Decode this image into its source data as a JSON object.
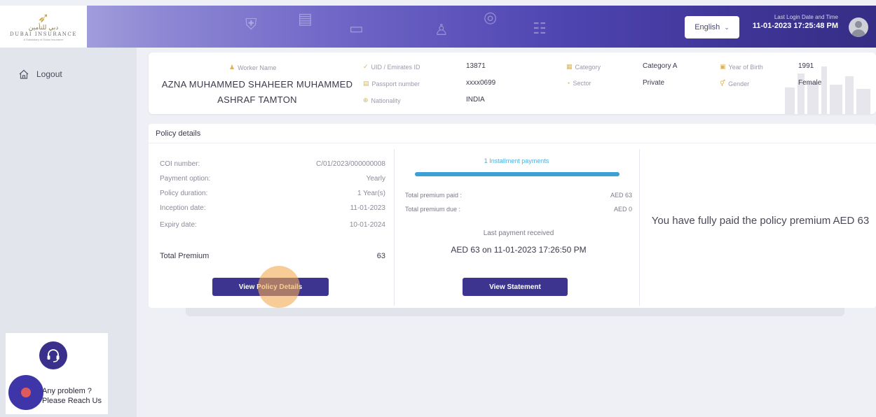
{
  "header": {
    "logo": {
      "arabic": "دبي للتأمين",
      "name": "DUBAI INSURANCE",
      "sub": "A Subsidiary of Dubai Insurance"
    },
    "language": "English",
    "last_login_label": "Last Login Date and Time",
    "last_login_value": "11-01-2023 17:25:48 PM"
  },
  "sidebar": {
    "logout_label": "Logout",
    "help_line1": "Any problem ?",
    "help_line2": "Please Reach Us"
  },
  "worker": {
    "name_label": "Worker Name",
    "name_value": "AZNA MUHAMMED SHAHEER MUHAMMED ASHRAF TAMTON",
    "uid_label": "UID / Emirates ID",
    "uid_value": "13871",
    "passport_label": "Passport number",
    "passport_value": "xxxx0699",
    "nationality_label": "Nationality",
    "nationality_value": "INDIA",
    "category_label": "Category",
    "category_value": "Category A",
    "sector_label": "Sector",
    "sector_value": "Private",
    "yob_label": "Year of Birth",
    "yob_value": "1991",
    "gender_label": "Gender",
    "gender_value": "Female"
  },
  "policy": {
    "header": "Policy details",
    "rows": [
      {
        "label": "COI number:",
        "value": "C/01/2023/000000008"
      },
      {
        "label": "Payment option:",
        "value": "Yearly"
      },
      {
        "label": "Policy duration:",
        "value": "1 Year(s)"
      },
      {
        "label": "Inception date:",
        "value": "11-01-2023"
      },
      {
        "label": "Expiry date:",
        "value": "10-01-2024"
      }
    ],
    "total_label": "Total Premium",
    "total_value": "63",
    "view_details_button": "View Policy Details",
    "installments_label": "1 Installment payments",
    "installments_progress": 1.0,
    "premium_paid_label": "Total premium paid :",
    "premium_paid_value": "AED 63",
    "premium_due_label": "Total premium due :",
    "premium_due_value": "AED 0",
    "last_payment_label": "Last payment received",
    "last_payment_value": "AED 63 on 11-01-2023 17:26:50 PM",
    "view_statement_button": "View Statement",
    "paid_message": "You have fully paid the policy premium AED 63"
  },
  "colors": {
    "primary": "#3d3490",
    "accent_blue": "#3c9fd6",
    "cursor_highlight": "#f2aa50"
  }
}
